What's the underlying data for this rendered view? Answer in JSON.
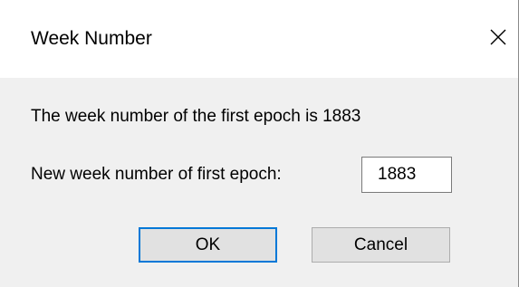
{
  "window": {
    "title": "Week Number",
    "close_icon": "close-icon"
  },
  "body": {
    "message": "The week number of the first epoch is 1883",
    "field_label": "New week number of first epoch:",
    "field_value": "1883"
  },
  "buttons": {
    "ok_label": "OK",
    "cancel_label": "Cancel"
  },
  "colors": {
    "focus_border": "#0078d7",
    "button_face": "#e1e1e1",
    "dialog_background": "#f0f0f0",
    "titlebar_background": "#ffffff"
  }
}
